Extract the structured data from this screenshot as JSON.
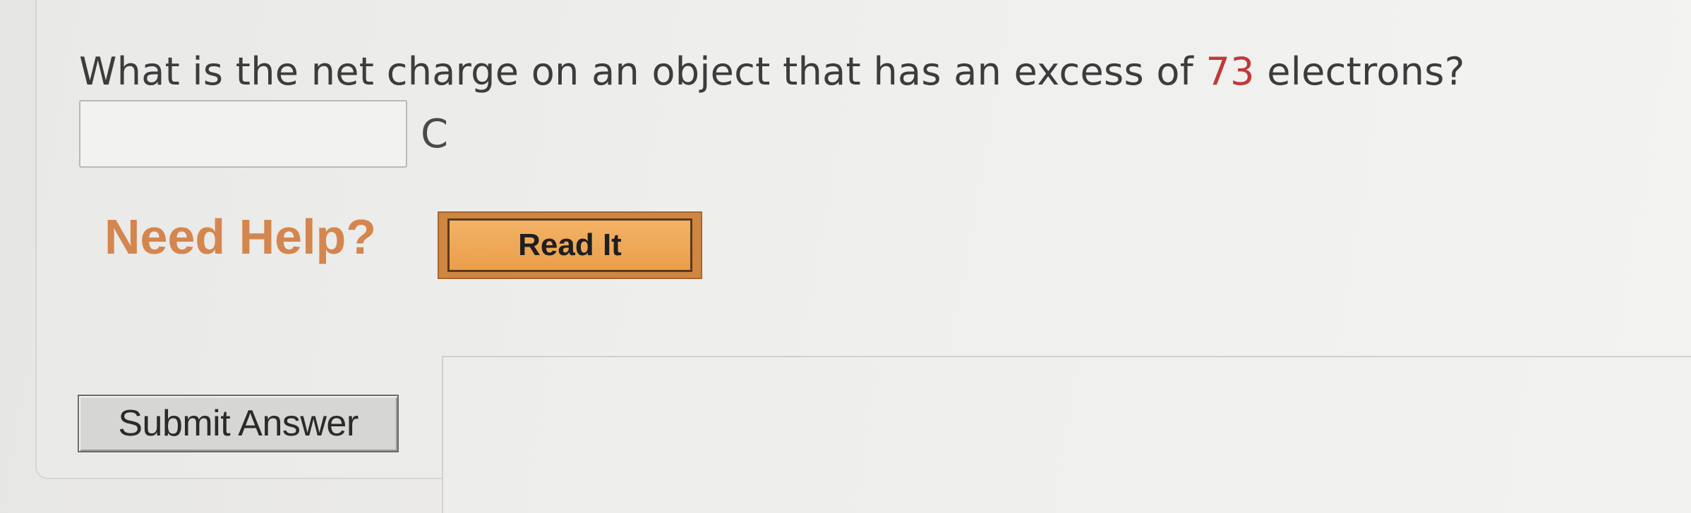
{
  "question": {
    "prefix": "What is the net charge on an object that has an excess of ",
    "value": "73",
    "suffix": " electrons?"
  },
  "answer": {
    "value": "",
    "unit": "C"
  },
  "help": {
    "label": "Need Help?",
    "read_it_label": "Read It"
  },
  "submit": {
    "label": "Submit Answer"
  },
  "colors": {
    "highlight_value": "#c0393b",
    "help_text": "#d4864e",
    "read_it_button": "#eb9e4b"
  }
}
